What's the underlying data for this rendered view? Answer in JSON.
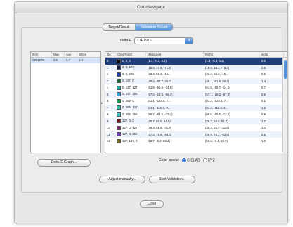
{
  "window": {
    "title": "ColorNavigator"
  },
  "tabs": [
    {
      "label": "Target/Result",
      "active": false
    },
    {
      "label": "Validation Result",
      "active": true
    }
  ],
  "delta": {
    "label": "delta-E",
    "selected": "CIE1976"
  },
  "left_table": {
    "columns": [
      "Item",
      "Max",
      "Ave",
      "White"
    ],
    "rows": [
      {
        "item": "CIE1976",
        "max": "2.6",
        "ave": "0.7",
        "white": "0.6"
      }
    ]
  },
  "right_table": {
    "columns": [
      "No.",
      "Color Patch",
      "Measured",
      "Ref/Is",
      "delta"
    ],
    "rows": [
      {
        "no": "0",
        "color": "#0a0a0a",
        "patch": "0, 0, 0",
        "measured": "(1.4, -0.3, 0.2)",
        "ref": "(1.4, -0.3, 0.2)",
        "delta": "0.0",
        "selected": true
      },
      {
        "no": "1",
        "color": "#15255a",
        "patch": "0, 0, 127",
        "measured": "(15.4, 37.5, -71.8)",
        "ref": "(16.4, 35.2, -75.3)",
        "delta": "2.6",
        "selected": false
      },
      {
        "no": "2",
        "color": "#1f3fb0",
        "patch": "0, 0, 255",
        "measured": "(32.4, 55.3, -16...",
        "ref": "(32.4, 55.3, -15...",
        "delta": "0.5",
        "selected": false
      },
      {
        "no": "3",
        "color": "#1b6f3a",
        "patch": "0, 127, 0",
        "measured": "(48.4, -82.7, 46.3)",
        "ref": "(49.1, -81.8, 50.3)",
        "delta": "1.4",
        "selected": false
      },
      {
        "no": "4",
        "color": "#1aa89c",
        "patch": "0, 127, 127",
        "measured": "(51.8, -56.0, -14.8)",
        "ref": "(51.6, -55.7, -14.2)",
        "delta": "0.7",
        "selected": false
      },
      {
        "no": "5",
        "color": "#2c9fd8",
        "patch": "0, 127, 255",
        "measured": "(57.0, -18.5, -68.3)",
        "ref": "(57.1, -18.2, -67.8)",
        "delta": "0.6",
        "selected": false
      },
      {
        "no": "6",
        "color": "#19a04a",
        "patch": "0, 255, 0",
        "measured": "(81.1, -124.5, 7...",
        "ref": "(81.2, -124.5, 7...",
        "delta": "0.1",
        "selected": false
      },
      {
        "no": "7",
        "color": "#23c6a6",
        "patch": "0, 255, 127",
        "measured": "(84.1, -110.7, 3...",
        "ref": "(84.2, -111.4, 3...",
        "delta": "1.2",
        "selected": false
      },
      {
        "no": "8",
        "color": "#29d3d6",
        "patch": "0, 255, 255",
        "measured": "(86.7, -84.5, -12.4)",
        "ref": "(86.6, -85.5, -13.0)",
        "delta": "0.9",
        "selected": false
      },
      {
        "no": "9",
        "color": "#6a1518",
        "patch": "127, 0, 0",
        "measured": "(35.7, 60.5, 51.5)",
        "ref": "(35.7, 58.9, 51.7)",
        "delta": "1.2",
        "selected": false
      },
      {
        "no": "10",
        "color": "#7a1f6a",
        "patch": "127, 0, 127",
        "measured": "(39.3, 65.6, -31.8)",
        "ref": "(39.4, 64.4, -31.6)",
        "delta": "1.0",
        "selected": false
      },
      {
        "no": "11",
        "color": "#6b2fc0",
        "patch": "127, 0, 255",
        "measured": "(47.3, 75.6, -93.3)",
        "ref": "(46.9, 75.2, -93.8)",
        "delta": "0.5",
        "selected": false
      },
      {
        "no": "12",
        "color": "#7a6a1a",
        "patch": "127, 127, 0",
        "measured": "(58.7, -9.4, 63.4)",
        "ref": "(58.6, -8.4, 63.3)",
        "delta": "1.0",
        "selected": false
      }
    ]
  },
  "buttons": {
    "graph": "Delta-E Graph...",
    "adjust": "Adjust manually...",
    "validate": "Start Validation...",
    "close": "Close"
  },
  "colorspace": {
    "label": "Color space:",
    "options": [
      "CIELAB",
      "XYZ"
    ],
    "selected": "CIELAB"
  },
  "colors": {
    "accent": "#4f8fdc",
    "selected_row": "#1f3e7a"
  }
}
